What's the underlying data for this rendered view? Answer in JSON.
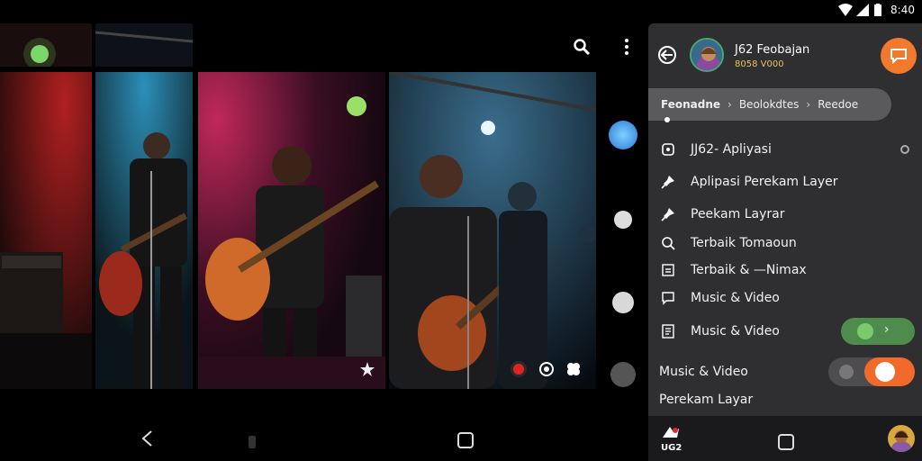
{
  "status_bar": {
    "time": "8:40"
  },
  "gallery": {
    "search_icon": "search-icon",
    "more_icon": "more-vert-icon"
  },
  "panel": {
    "user": {
      "name": "J62 Feobajan",
      "subtitle": "8058 V000"
    },
    "breadcrumb": [
      "Feonadne",
      "Beolokdtes",
      "Reedoe"
    ],
    "menu": [
      {
        "label": "JJ62- Apliyasi",
        "icon": "app-icon"
      },
      {
        "label": "Aplipasi Perekam Layer",
        "icon": "pin-icon"
      },
      {
        "label": "Peekam Layrar",
        "icon": "pin-icon"
      },
      {
        "label": "Terbaik Tomaoun",
        "icon": "search-icon"
      },
      {
        "label": "Terbaik & —Nimax",
        "icon": "list-icon"
      },
      {
        "label": "Music & Video",
        "icon": "chat-icon"
      },
      {
        "label": "Music & Video",
        "icon": "doc-icon"
      },
      {
        "label": "Music & Video",
        "icon": ""
      },
      {
        "label": "Perekam Layar",
        "icon": ""
      }
    ],
    "toggles": {
      "green_on": true,
      "orange_on": true
    }
  },
  "bottom": {
    "app_label": "UG2"
  },
  "colors": {
    "accent": "#f27a2c",
    "panel_bg": "#2f2f31",
    "toggle_green": "#4e8c4e"
  }
}
